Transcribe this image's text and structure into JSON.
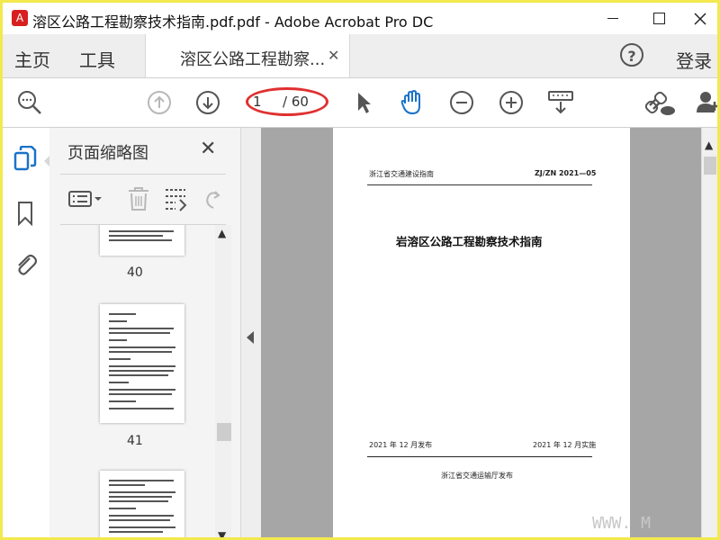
{
  "window": {
    "title": "溶区公路工程勘察技术指南.pdf.pdf - Adobe Acrobat Pro DC",
    "icon": "acrobat-icon",
    "controls": [
      "minimize",
      "maximize",
      "close"
    ]
  },
  "tabs": {
    "home": "主页",
    "tools": "工具",
    "document": "溶区公路工程勘察...",
    "help_icon": "help-icon",
    "login": "登录"
  },
  "toolbar": {
    "icons": [
      "search-zoom-icon",
      "page-up-icon",
      "page-down-icon",
      "select-pointer-icon",
      "hand-tool-icon",
      "zoom-out-icon",
      "zoom-in-icon",
      "keyboard-scroll-icon",
      "share-link-icon",
      "add-user-icon"
    ],
    "current_page": "1",
    "total_pages": "/ 60",
    "highlight_color": "#e03030"
  },
  "left_rail": {
    "icons": [
      "page-thumbnails-icon",
      "bookmark-icon",
      "attachment-icon"
    ],
    "active_color": "#1a73c8"
  },
  "thumbnails": {
    "title": "页面缩略图",
    "pages": [
      {
        "number": "40"
      },
      {
        "number": "41"
      }
    ]
  },
  "document": {
    "header_left": "浙江省交通建设指南",
    "header_right": "ZJ/ZN 2021—05",
    "title": "岩溶区公路工程勘察技术指南",
    "publish_date": "2021 年 12 月发布",
    "implement_date": "2021 年 12 月实施",
    "publisher": "浙江省交通运输厅发布"
  },
  "watermark": "WWW.          M"
}
